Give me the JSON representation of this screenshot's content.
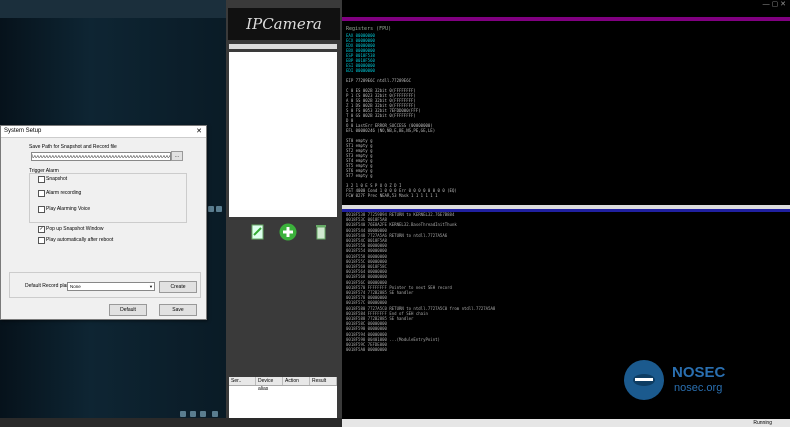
{
  "ipcamera": {
    "title": "IPCamera",
    "table_headers": [
      "Ser..",
      "Device alias",
      "Action",
      "Result"
    ]
  },
  "dialog": {
    "title": "System Setup",
    "path_label": "Save Path for Snapshot and Record file",
    "path_value": "\\AAAAAAAAAAAAAAAAAAAAAAAAAAAAAAAAAAAAAAAAAAAAAAAAAAAAAAAAAAAAA",
    "browse_label": "...",
    "trigger_label": "Trigger Alarm",
    "options": [
      {
        "label": "Snapshot",
        "checked": false
      },
      {
        "label": "Alarm recording",
        "checked": false
      },
      {
        "label": "Play Alarming Voice",
        "checked": false
      }
    ],
    "popup_options": [
      {
        "label": "Pop up Snapshot Window",
        "checked": true
      },
      {
        "label": "Play automatically after reboot",
        "checked": false
      }
    ],
    "record_plan_label": "Default Record plan",
    "record_plan_value": "None",
    "create_label": "Create",
    "default_label": "Default",
    "save_label": "Save"
  },
  "debugger": {
    "reg_title": "Registers (FPU)",
    "registers": [
      "EAX 00000000",
      "ECX 00000000",
      "EDX 00000000",
      "EBX 00000000",
      "ESP 0018F538",
      "EBP 0018F560",
      "ESI 00000000",
      "EDI 00000000",
      "",
      "EIP 77289E6C ntdll.77289E6C",
      "",
      "C 0  ES 002B 32bit 0(FFFFFFFF)",
      "P 1  CS 0023 32bit 0(FFFFFFFF)",
      "A 0  SS 002B 32bit 0(FFFFFFFF)",
      "Z 1  DS 002B 32bit 0(FFFFFFFF)",
      "S 0  FS 0053 32bit 7EFDD000(FFF)",
      "T 0  GS 002B 32bit 0(FFFFFFFF)",
      "D 0",
      "O 0  LastErr ERROR_SUCCESS (00000000)",
      "EFL 00000246 (NO,NB,E,BE,NS,PE,GE,LE)",
      "",
      "ST0 empty g",
      "ST1 empty g",
      "ST2 empty g",
      "ST3 empty g",
      "ST4 empty g",
      "ST5 empty g",
      "ST6 empty g",
      "ST7 empty g",
      "",
      "           3 2 1 0      E S P U O Z D I",
      "FST 4000  Cond 1 0 0 0  Err 0 0 0 0 0 0 0 0  (EQ)",
      "FCW 027F  Prec NEAR,53  Mask    1 1 1 1 1 1"
    ],
    "stack": [
      "0018F538  77259B94  RETURN to KERNEL32.76E7B884",
      "0018F53C  0018F5A8",
      "0018F540  76E8A2FE  KERNEL32.BaseThreadInitThunk",
      "0018F544  00000000",
      "0018F548  7727A5A6  RETURN to ntdll.7727A5A6",
      "0018F54C  0018F5A8",
      "0018F550  00000000",
      "0018F554  00000000",
      "0018F558  00000000",
      "0018F55C  00000000",
      "0018F560  0018F58C",
      "0018F564  00000000",
      "0018F568  00000000",
      "0018F56C  00000000",
      "0018F570  FFFFFFFF  Pointer to next SEH record",
      "0018F574  772B2885  SE handler",
      "0018F578  00000000",
      "0018F57C  00000000",
      "0018F580  7727A5C0  RETURN to ntdll.7727A5C0 from ntdll.7727A5A8",
      "0018F584  FFFFFFFF  End of SEH chain",
      "0018F588  772B2885  SE handler",
      "0018F58C  00000000",
      "0018F590  00000000",
      "0018F594  00000000",
      "0018F598  00401000  ...(ModuleEntryPoint)",
      "0018F59C  7EFDE000",
      "0018F5A0  00000000"
    ],
    "status": "Running"
  },
  "logo": {
    "name": "NOSEC",
    "site": "nosec.org"
  }
}
